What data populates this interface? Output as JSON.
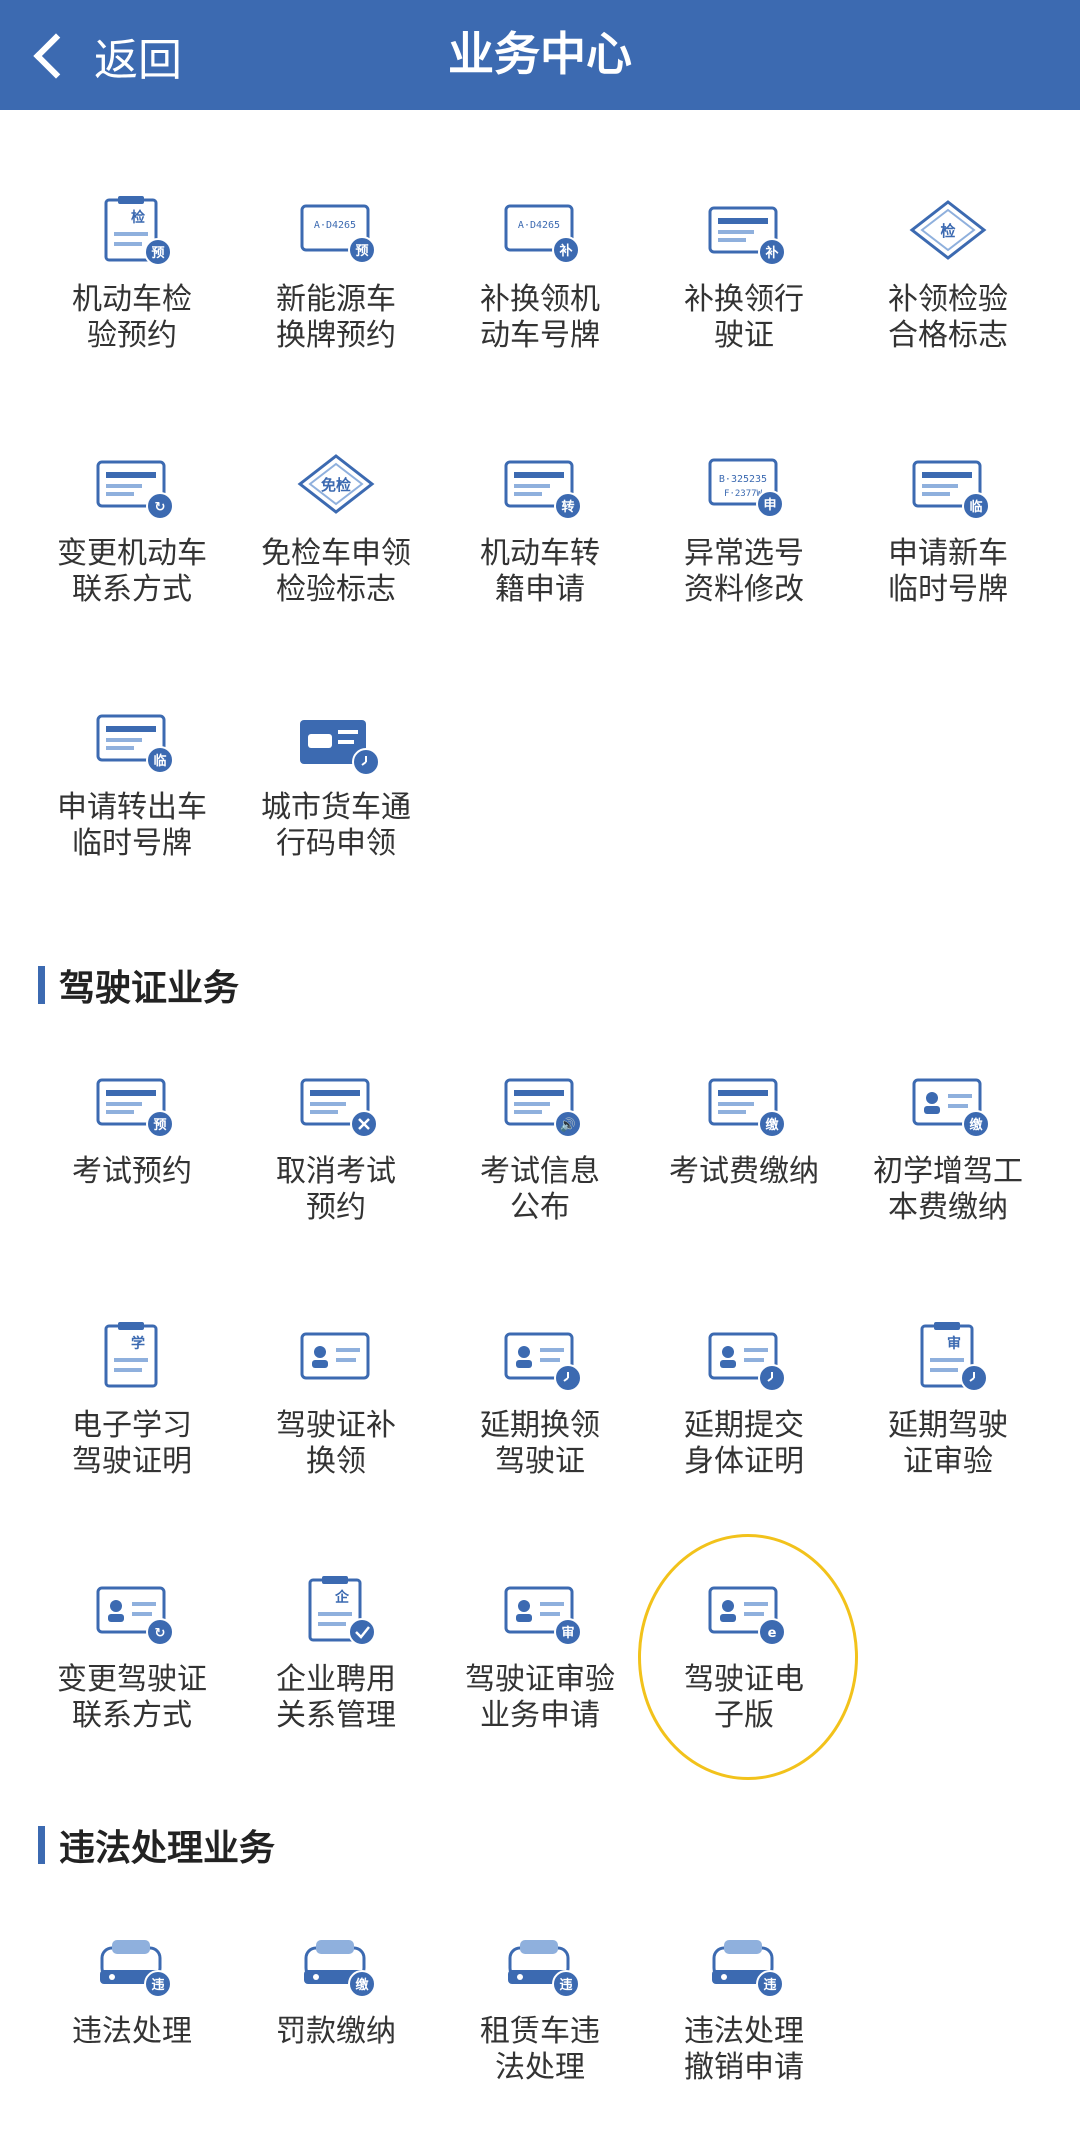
{
  "header": {
    "back_label": "返回",
    "title": "业务中心"
  },
  "sections": {
    "license": "驾驶证业务",
    "violation": "违法处理业务"
  },
  "vehicle_items": [
    {
      "label": "机动车检\n验预约",
      "icon": "vehicle-inspection-appointment-icon",
      "badge": "预",
      "top": "检"
    },
    {
      "label": "新能源车\n换牌预约",
      "icon": "new-energy-plate-change-icon",
      "badge": "预",
      "plate": "A·D4265"
    },
    {
      "label": "补换领机\n动车号牌",
      "icon": "replace-license-plate-icon",
      "badge": "补",
      "plate": "A·D4265"
    },
    {
      "label": "补换领行\n驶证",
      "icon": "replace-driving-permit-icon",
      "badge": "补"
    },
    {
      "label": "补领检验\n合格标志",
      "icon": "inspection-mark-icon",
      "badge": "",
      "top": "检"
    },
    {
      "label": "变更机动车\n联系方式",
      "icon": "vehicle-contact-change-icon",
      "badge": ""
    },
    {
      "label": "免检车申领\n检验标志",
      "icon": "exempt-inspection-icon",
      "badge": "",
      "top": "免检"
    },
    {
      "label": "机动车转\n籍申请",
      "icon": "vehicle-transfer-icon",
      "badge": "转"
    },
    {
      "label": "异常选号\n资料修改",
      "icon": "plate-selection-edit-icon",
      "badge": "申",
      "plate": "B·325235",
      "plate2": "F·2377W"
    },
    {
      "label": "申请新车\n临时号牌",
      "icon": "new-car-temp-plate-icon",
      "badge": "临"
    },
    {
      "label": "申请转出车\n临时号牌",
      "icon": "transfer-out-temp-plate-icon",
      "badge": "临"
    },
    {
      "label": "城市货车通\n行码申领",
      "icon": "truck-pass-icon",
      "badge": ""
    }
  ],
  "license_items": [
    {
      "label": "考试预约",
      "icon": "exam-appointment-icon",
      "badge": "预"
    },
    {
      "label": "取消考试\n预约",
      "icon": "cancel-exam-icon",
      "badge": "×"
    },
    {
      "label": "考试信息\n公布",
      "icon": "exam-info-icon",
      "badge": "🔊"
    },
    {
      "label": "考试费缴纳",
      "icon": "exam-fee-icon",
      "badge": "缴"
    },
    {
      "label": "初学增驾工\n本费缴纳",
      "icon": "learner-fee-icon",
      "badge": "缴"
    },
    {
      "label": "电子学习\n驾驶证明",
      "icon": "learning-certificate-icon",
      "badge": "",
      "top": "学"
    },
    {
      "label": "驾驶证补\n换领",
      "icon": "license-replace-icon",
      "badge": ""
    },
    {
      "label": "延期换领\n驾驶证",
      "icon": "delay-license-renewal-icon",
      "badge": "clock"
    },
    {
      "label": "延期提交\n身体证明",
      "icon": "delay-health-certificate-icon",
      "badge": "clock"
    },
    {
      "label": "延期驾驶\n证审验",
      "icon": "delay-license-review-icon",
      "badge": "clock",
      "top": "审"
    },
    {
      "label": "变更驾驶证\n联系方式",
      "icon": "license-contact-change-icon",
      "badge": ""
    },
    {
      "label": "企业聘用\n关系管理",
      "icon": "employment-management-icon",
      "badge": "✓",
      "top": "企"
    },
    {
      "label": "驾驶证审验\n业务申请",
      "icon": "license-review-application-icon",
      "badge": "审"
    },
    {
      "label": "驾驶证电\n子版",
      "icon": "electronic-license-icon",
      "badge": "e"
    }
  ],
  "violation_items": [
    {
      "label": "违法处理",
      "icon": "violation-handling-icon",
      "badge": "违"
    },
    {
      "label": "罚款缴纳",
      "icon": "fine-payment-icon",
      "badge": "缴"
    },
    {
      "label": "租赁车违\n法处理",
      "icon": "rental-violation-icon",
      "badge": "违"
    },
    {
      "label": "违法处理\n撤销申请",
      "icon": "violation-revoke-icon",
      "badge": "违"
    }
  ]
}
